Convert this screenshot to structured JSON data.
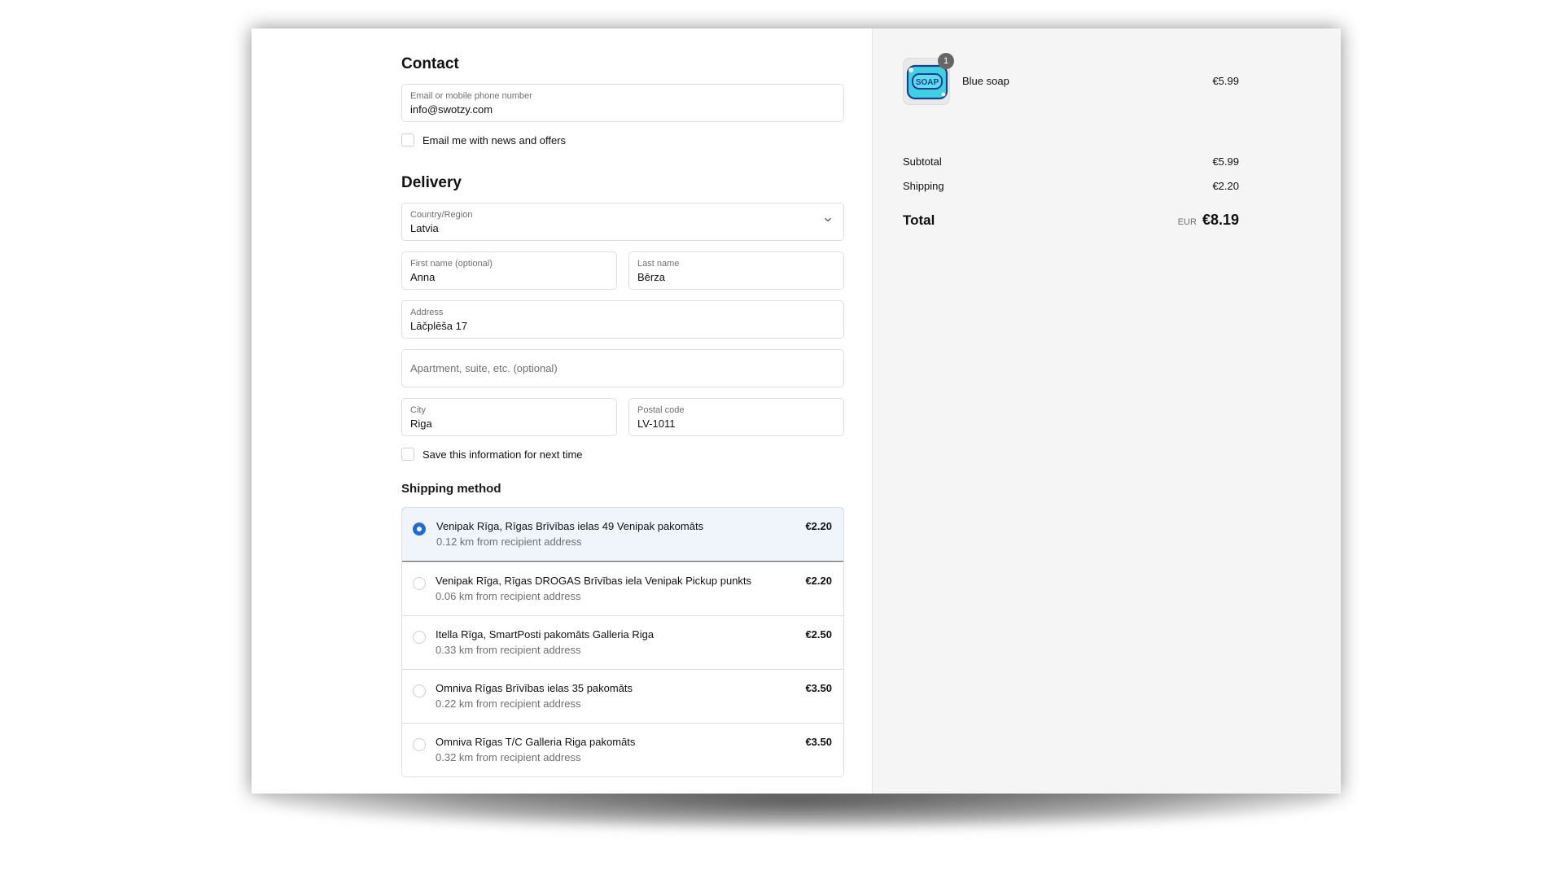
{
  "contact": {
    "heading": "Contact",
    "email_label": "Email or mobile phone number",
    "email_value": "info@swotzy.com",
    "news_checkbox_label": "Email me with news and offers"
  },
  "delivery": {
    "heading": "Delivery",
    "country_label": "Country/Region",
    "country_value": "Latvia",
    "first_name_label": "First name (optional)",
    "first_name_value": "Anna",
    "last_name_label": "Last name",
    "last_name_value": "Bērza",
    "address_label": "Address",
    "address_value": "Lāčplēša 17",
    "apartment_placeholder": "Apartment, suite, etc. (optional)",
    "city_label": "City",
    "city_value": "Riga",
    "postal_label": "Postal code",
    "postal_value": "LV-1011",
    "save_checkbox_label": "Save this information for next time"
  },
  "shipping": {
    "heading": "Shipping method",
    "options": [
      {
        "name": "Venipak Rīga, Rīgas Brīvības ielas 49 Venipak pakomāts",
        "distance": "0.12 km from recipient address",
        "price": "€2.20",
        "selected": true
      },
      {
        "name": "Venipak Rīga, Rīgas DROGAS Brīvības iela Venipak Pickup punkts",
        "distance": "0.06 km from recipient address",
        "price": "€2.20",
        "selected": false
      },
      {
        "name": "Itella Rīga, SmartPosti pakomāts Galleria Riga",
        "distance": "0.33 km from recipient address",
        "price": "€2.50",
        "selected": false
      },
      {
        "name": "Omniva Rīgas Brīvības ielas 35 pakomāts",
        "distance": "0.22 km from recipient address",
        "price": "€3.50",
        "selected": false
      },
      {
        "name": "Omniva Rīgas T/C Galleria Riga pakomāts",
        "distance": "0.32 km from recipient address",
        "price": "€3.50",
        "selected": false
      }
    ]
  },
  "summary": {
    "product": {
      "name": "Blue soap",
      "price": "€5.99",
      "quantity": "1",
      "image_text": "SOAP"
    },
    "subtotal_label": "Subtotal",
    "subtotal_value": "€5.99",
    "shipping_label": "Shipping",
    "shipping_value": "€2.20",
    "total_label": "Total",
    "currency": "EUR",
    "total_value": "€8.19"
  },
  "colors": {
    "accent": "#1f6cd6",
    "summary_bg": "#f5f5f5",
    "soap_blue": "#3fd0e6"
  }
}
